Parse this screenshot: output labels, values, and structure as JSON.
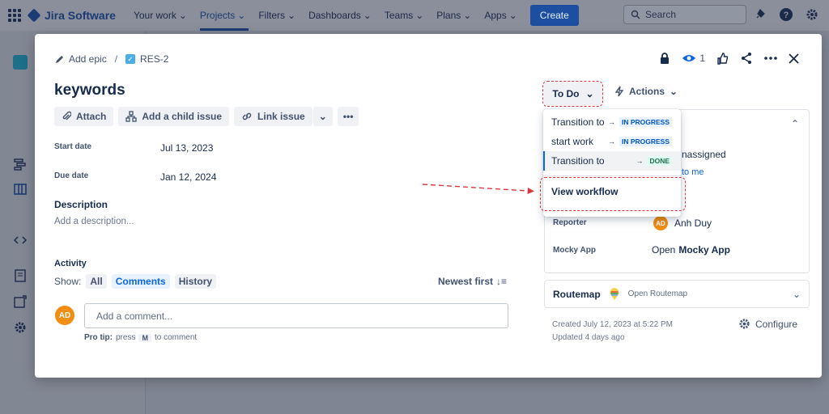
{
  "topnav": {
    "product": "Jira Software",
    "items": [
      {
        "label": "Your work",
        "active": false
      },
      {
        "label": "Projects",
        "active": true
      },
      {
        "label": "Filters",
        "active": false
      },
      {
        "label": "Dashboards",
        "active": false
      },
      {
        "label": "Teams",
        "active": false
      },
      {
        "label": "Plans",
        "active": false
      },
      {
        "label": "Apps",
        "active": false
      }
    ],
    "create_label": "Create",
    "search_placeholder": "Search"
  },
  "issue": {
    "add_epic": "Add epic",
    "key": "RES-2",
    "title": "keywords",
    "toolbar": {
      "attach": "Attach",
      "add_child": "Add a child issue",
      "link_issue": "Link issue"
    },
    "fields": {
      "start_date_label": "Start date",
      "start_date": "Jul 13, 2023",
      "due_date_label": "Due date",
      "due_date": "Jan 12, 2024"
    },
    "description_heading": "Description",
    "description_placeholder": "Add a description...",
    "activity": {
      "heading": "Activity",
      "show_label": "Show:",
      "filters": [
        {
          "label": "All",
          "selected": false
        },
        {
          "label": "Comments",
          "selected": true
        },
        {
          "label": "History",
          "selected": false
        }
      ],
      "sort_label": "Newest first",
      "comment_placeholder": "Add a comment...",
      "user_initials": "AD",
      "protip_label": "Pro tip:",
      "protip_press": "press",
      "protip_key": "M",
      "protip_rest": "to comment"
    }
  },
  "header": {
    "watch_count": "1"
  },
  "status": {
    "current": "To Do",
    "actions_label": "Actions"
  },
  "dropdown": {
    "items": [
      {
        "label": "Transition to",
        "target": "IN PROGRESS",
        "kind": "prog"
      },
      {
        "label": "start work",
        "target": "IN PROGRESS",
        "kind": "prog"
      },
      {
        "label": "Transition to",
        "target": "DONE",
        "kind": "done"
      }
    ],
    "view_workflow": "View workflow"
  },
  "details": {
    "assignee_value": "nassigned",
    "assign_link": "to me",
    "reporter_label": "Reporter",
    "reporter_name": "Anh Duy",
    "reporter_initials": "AD",
    "mocky_label": "Mocky App",
    "mocky_open": "Open",
    "mocky_name": "Mocky App"
  },
  "routemap": {
    "name": "Routemap",
    "open": "Open Routemap"
  },
  "meta": {
    "created": "Created July 12, 2023 at 5:22 PM",
    "updated": "Updated 4 days ago",
    "configure": "Configure"
  },
  "colors": {
    "annotation": "#d9363e",
    "accent": "#0c66e4"
  }
}
